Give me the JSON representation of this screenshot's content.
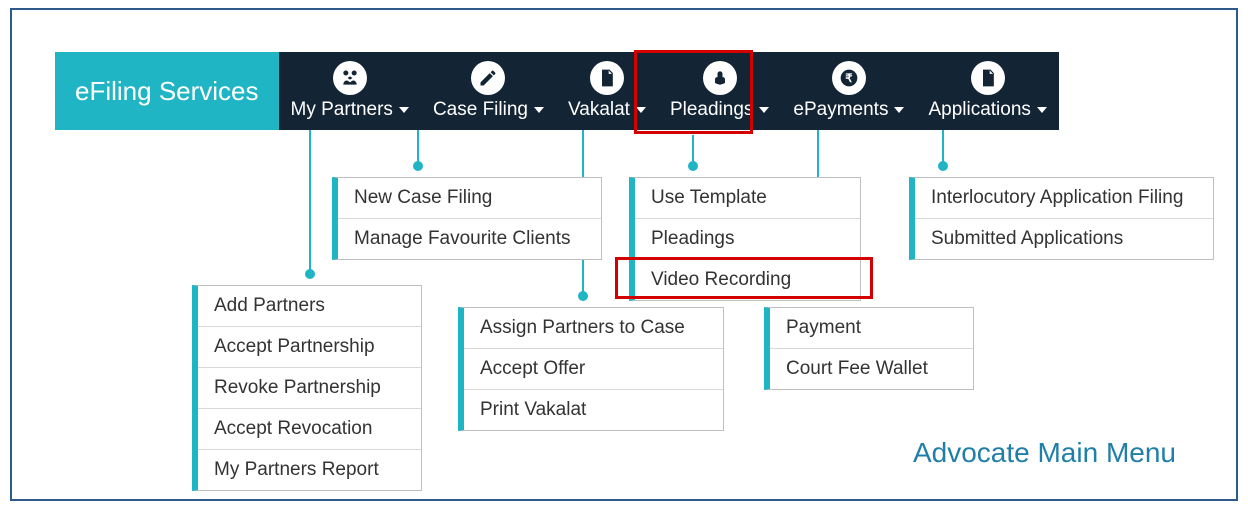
{
  "brand": "eFiling Services",
  "nav": {
    "my_partners": "My Partners",
    "case_filing": "Case Filing",
    "vakalat": "Vakalat",
    "pleadings": "Pleadings",
    "epayments": "ePayments",
    "applications": "Applications"
  },
  "menus": {
    "my_partners": {
      "0": "Add Partners",
      "1": "Accept Partnership",
      "2": "Revoke Partnership",
      "3": "Accept Revocation",
      "4": "My Partners Report"
    },
    "case_filing": {
      "0": "New Case Filing",
      "1": "Manage Favourite Clients"
    },
    "vakalat": {
      "0": "Assign Partners to Case",
      "1": "Accept Offer",
      "2": "Print Vakalat"
    },
    "pleadings": {
      "0": "Use Template",
      "1": "Pleadings",
      "2": "Video Recording"
    },
    "epayments": {
      "0": "Payment",
      "1": "Court Fee Wallet"
    },
    "applications": {
      "0": "Interlocutory Application Filing",
      "1": "Submitted Applications"
    }
  },
  "caption": "Advocate Main Menu"
}
